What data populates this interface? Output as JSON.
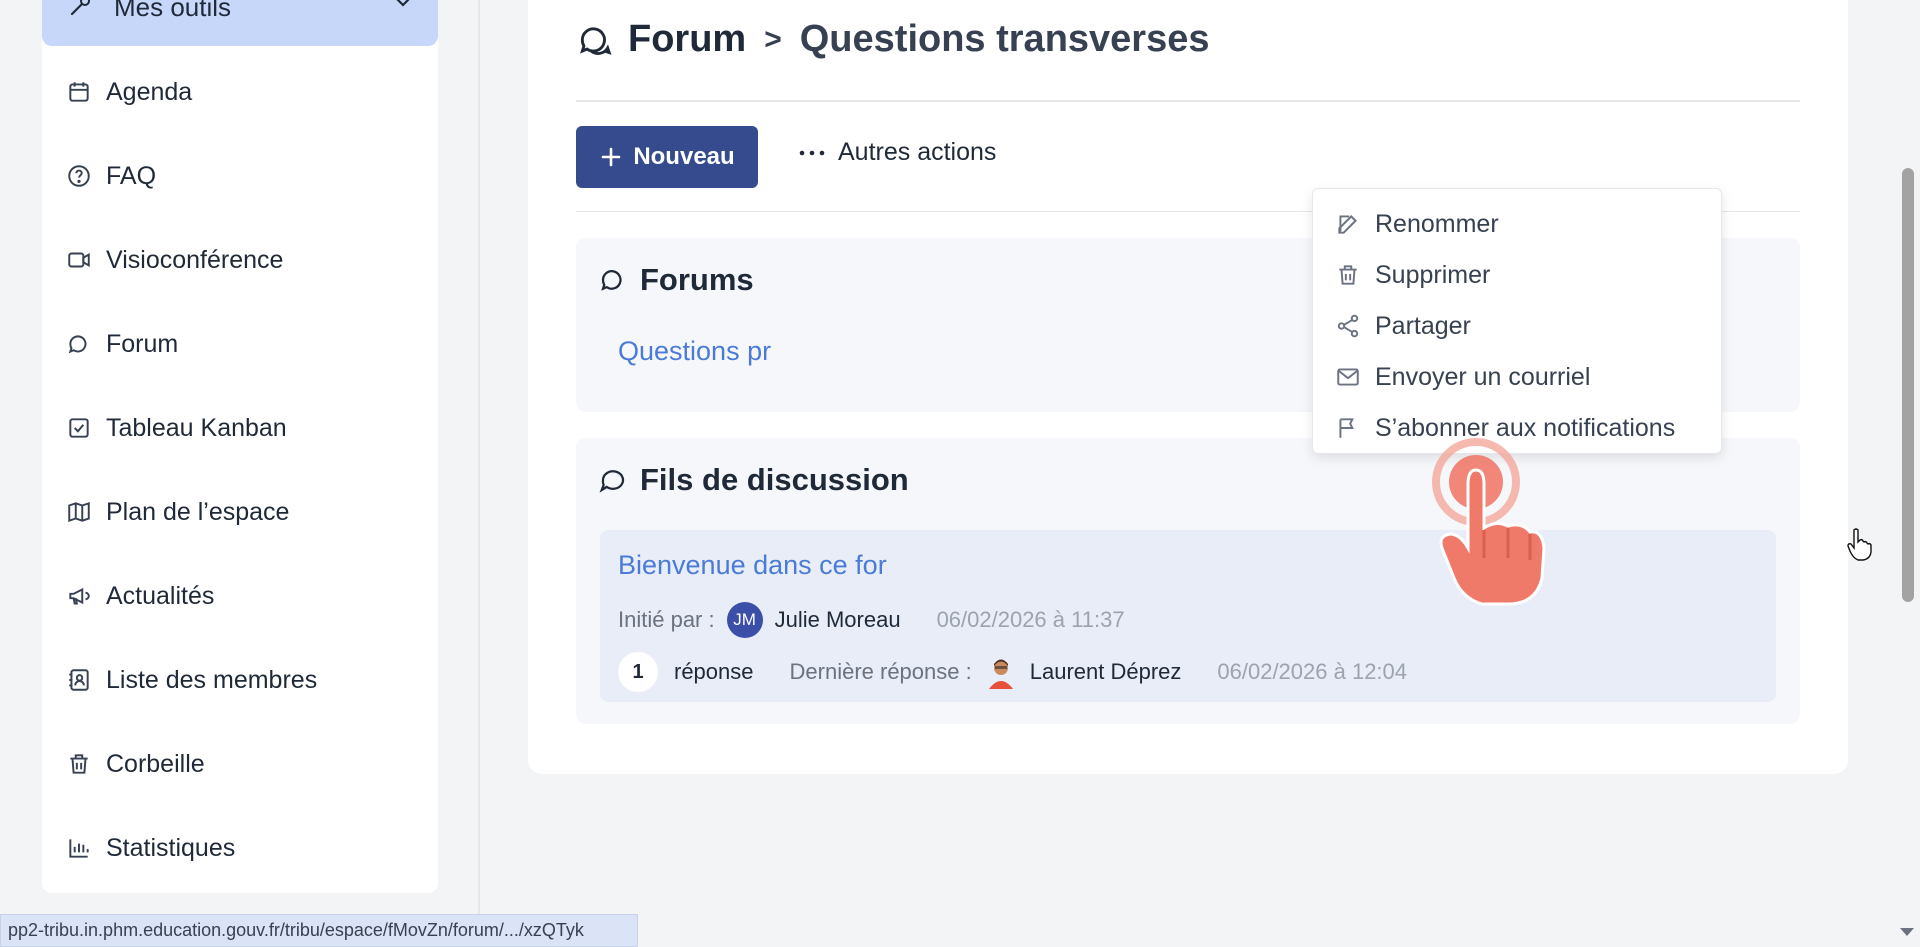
{
  "sidebar": {
    "top_label": "Mes outils",
    "items": [
      {
        "label": "Agenda",
        "icon": "calendar-icon"
      },
      {
        "label": "FAQ",
        "icon": "help-circle-icon"
      },
      {
        "label": "Visioconférence",
        "icon": "video-icon"
      },
      {
        "label": "Forum",
        "icon": "chat-bubbles-icon"
      },
      {
        "label": "Tableau Kanban",
        "icon": "checkbox-icon"
      },
      {
        "label": "Plan de l’espace",
        "icon": "map-icon"
      },
      {
        "label": "Actualités",
        "icon": "megaphone-icon"
      },
      {
        "label": "Liste des membres",
        "icon": "contact-card-icon"
      },
      {
        "label": "Corbeille",
        "icon": "trash-icon"
      },
      {
        "label": "Statistiques",
        "icon": "bar-chart-icon"
      }
    ]
  },
  "header": {
    "breadcrumb_root": "Forum",
    "breadcrumb_current": "Questions transverses"
  },
  "toolbar": {
    "new_label": "Nouveau",
    "more_label": "Autres actions"
  },
  "dropdown": {
    "items": [
      {
        "label": "Renommer",
        "icon": "edit-icon"
      },
      {
        "label": "Supprimer",
        "icon": "trash-icon"
      },
      {
        "label": "Partager",
        "icon": "share-icon"
      },
      {
        "label": "Envoyer un courriel",
        "icon": "mail-icon"
      },
      {
        "label": "S’abonner aux notifications",
        "icon": "flag-icon"
      }
    ]
  },
  "forums_section": {
    "title": "Forums",
    "link_text": "Questions pr"
  },
  "threads_section": {
    "title": "Fils de discussion",
    "thread": {
      "title": "Bienvenue dans ce for",
      "initiated_label": "Initié par :",
      "initiator_initials": "JM",
      "initiator_name": "Julie Moreau",
      "initiated_date": "06/02/2026 à 11:37",
      "reply_count": "1",
      "reply_label": "réponse",
      "last_reply_label": "Dernière réponse :",
      "last_reply_name": "Laurent Déprez",
      "last_reply_date": "06/02/2026 à 12:04"
    }
  },
  "statusbar": {
    "url": "pp2-tribu.in.phm.education.gouv.fr/tribu/espace/fMovZn/forum/.../xzQTyk"
  },
  "colors": {
    "primary": "#354b8e",
    "link": "#4b7bd8",
    "sidebar_active": "#c7d7fa",
    "pointer": "#f07a6a"
  }
}
